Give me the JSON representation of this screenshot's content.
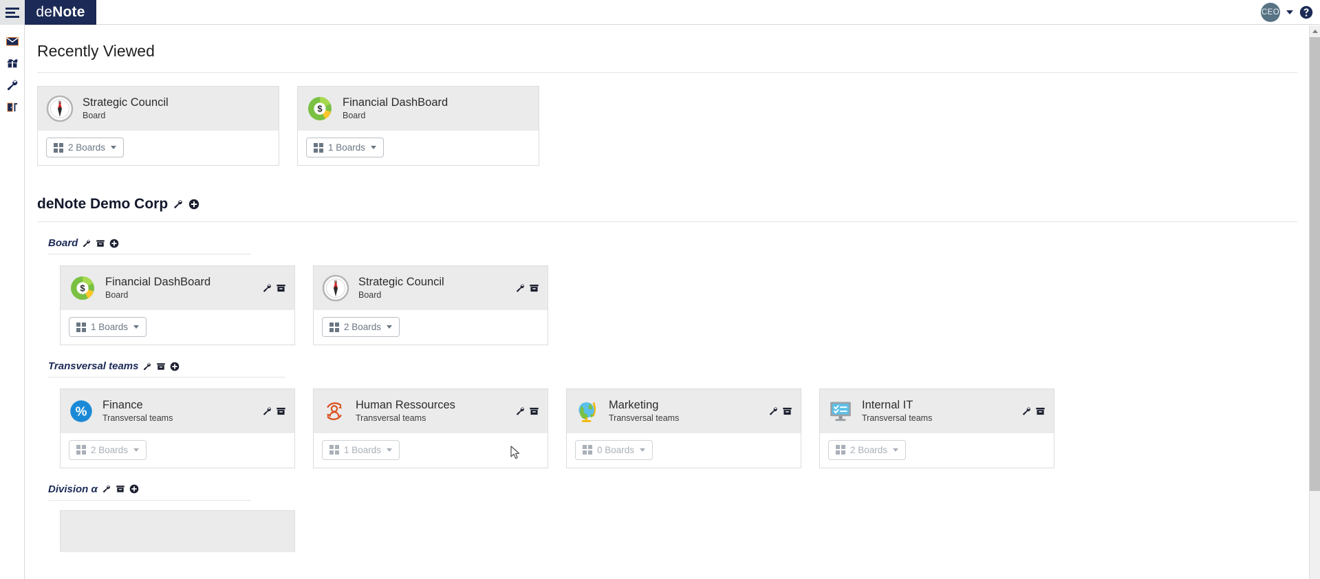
{
  "topbar": {
    "hamburger_icon": "hamburger-menu-icon",
    "brand_thin": "de",
    "brand_bold": "Note",
    "avatar_initials": "CEO",
    "avatar_caret_icon": "chevron-down-icon",
    "help_icon": "question-circle-icon",
    "brand_bg": "#1b2a56"
  },
  "sidebar": {
    "items": [
      {
        "name": "mail",
        "icon": "envelope-icon"
      },
      {
        "name": "gifts",
        "icon": "gift-icon"
      },
      {
        "name": "tools",
        "icon": "wrench-icon"
      },
      {
        "name": "logout",
        "icon": "exit-door-icon"
      }
    ]
  },
  "recently_viewed": {
    "heading": "Recently Viewed",
    "cards": [
      {
        "title": "Strategic Council",
        "subtitle": "Board",
        "icon": "compass-icon",
        "boards_label": "2 Boards",
        "grid_icon": "grid-icon",
        "caret_icon": "caret-down-icon"
      },
      {
        "title": "Financial DashBoard",
        "subtitle": "Board",
        "icon": "donut-chart-dollar-icon",
        "boards_label": "1 Boards",
        "grid_icon": "grid-icon",
        "caret_icon": "caret-down-icon"
      }
    ]
  },
  "organization": {
    "title": "deNote Demo Corp",
    "tools": [
      "wrench-icon",
      "plus-circle-icon"
    ],
    "groups": [
      {
        "label": "Board",
        "tools": [
          "wrench-icon",
          "archive-icon",
          "plus-circle-icon"
        ],
        "cards": [
          {
            "title": "Financial DashBoard",
            "subtitle": "Board",
            "icon": "donut-chart-dollar-icon",
            "boards_label": "1 Boards",
            "muted": false,
            "tools": [
              "wrench-icon",
              "archive-icon"
            ]
          },
          {
            "title": "Strategic Council",
            "subtitle": "Board",
            "icon": "compass-icon",
            "boards_label": "2 Boards",
            "muted": false,
            "tools": [
              "wrench-icon",
              "archive-icon"
            ]
          }
        ]
      },
      {
        "label": "Transversal teams",
        "tools": [
          "wrench-icon",
          "archive-icon",
          "plus-circle-icon"
        ],
        "cards": [
          {
            "title": "Finance",
            "subtitle": "Transversal teams",
            "icon": "percent-circle-icon",
            "boards_label": "2 Boards",
            "muted": true,
            "tools": [
              "wrench-icon",
              "archive-icon"
            ]
          },
          {
            "title": "Human Ressources",
            "subtitle": "Transversal teams",
            "icon": "person-cycle-icon",
            "boards_label": "1 Boards",
            "muted": true,
            "tools": [
              "wrench-icon",
              "archive-icon"
            ]
          },
          {
            "title": "Marketing",
            "subtitle": "Transversal teams",
            "icon": "globe-icon",
            "boards_label": "0 Boards",
            "muted": true,
            "tools": [
              "wrench-icon",
              "archive-icon"
            ]
          },
          {
            "title": "Internal IT",
            "subtitle": "Transversal teams",
            "icon": "monitor-checklist-icon",
            "boards_label": "2 Boards",
            "muted": true,
            "tools": [
              "wrench-icon",
              "archive-icon"
            ]
          }
        ]
      },
      {
        "label": "Division α",
        "tools": [
          "wrench-icon",
          "archive-icon",
          "plus-circle-icon"
        ],
        "cards": []
      }
    ]
  },
  "scrollbar": {
    "up_arrow_icon": "scroll-up-arrow-icon",
    "thumb": "scroll-thumb"
  },
  "colors": {
    "brand_navy": "#1b2a56",
    "card_head_gray": "#ebebeb",
    "accent_green": "#7ac143",
    "accent_blue": "#1b8ad6",
    "accent_orange": "#d9501e"
  }
}
